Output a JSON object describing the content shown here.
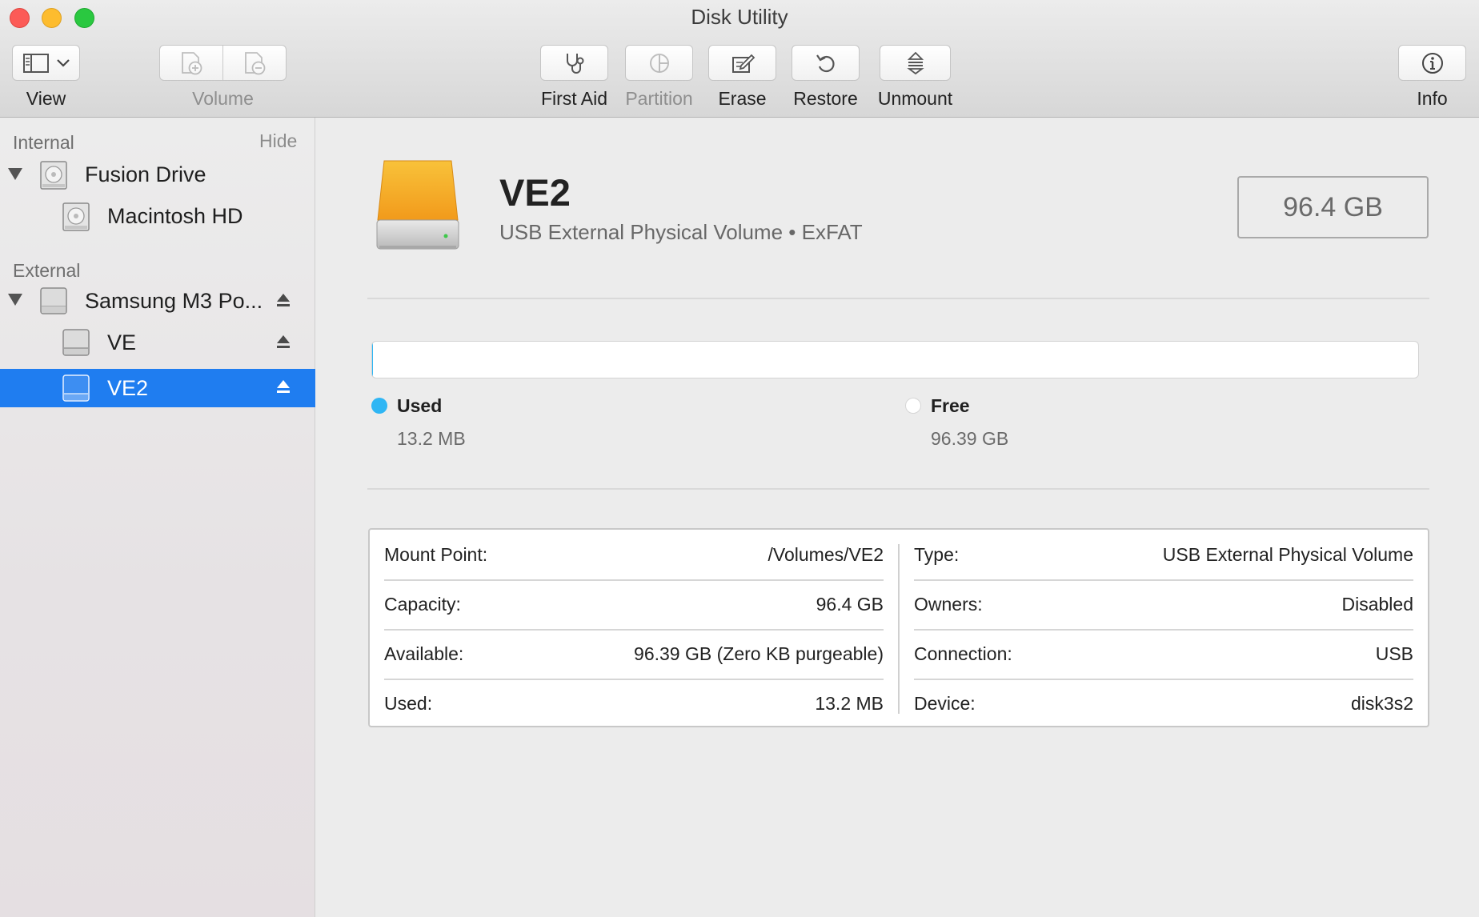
{
  "window": {
    "title": "Disk Utility"
  },
  "toolbar": {
    "view_label": "View",
    "volume_label": "Volume",
    "first_aid_label": "First Aid",
    "partition_label": "Partition",
    "erase_label": "Erase",
    "restore_label": "Restore",
    "unmount_label": "Unmount",
    "info_label": "Info"
  },
  "sidebar": {
    "internal_header": "Internal",
    "hide_label": "Hide",
    "external_header": "External",
    "internal_items": [
      {
        "label": "Fusion Drive"
      },
      {
        "label": "Macintosh HD"
      }
    ],
    "external_items": [
      {
        "label": "Samsung M3 Po..."
      },
      {
        "label": "VE"
      },
      {
        "label": "VE2"
      }
    ]
  },
  "volume": {
    "name": "VE2",
    "subtitle": "USB External Physical Volume • ExFAT",
    "size": "96.4 GB"
  },
  "usage": {
    "used_fraction": 0.0001,
    "used_label": "Used",
    "used_value": "13.2 MB",
    "free_label": "Free",
    "free_value": "96.39 GB",
    "used_color": "#2fb6f4",
    "free_color": "#ffffff"
  },
  "info": {
    "left": [
      {
        "key": "Mount Point:",
        "value": "/Volumes/VE2"
      },
      {
        "key": "Capacity:",
        "value": "96.4 GB"
      },
      {
        "key": "Available:",
        "value": "96.39 GB (Zero KB purgeable)"
      },
      {
        "key": "Used:",
        "value": "13.2 MB"
      }
    ],
    "right": [
      {
        "key": "Type:",
        "value": "USB External Physical Volume"
      },
      {
        "key": "Owners:",
        "value": "Disabled"
      },
      {
        "key": "Connection:",
        "value": "USB"
      },
      {
        "key": "Device:",
        "value": "disk3s2"
      }
    ]
  },
  "colors": {
    "selection": "#1f7df0",
    "drive_orange": "#f5a623"
  }
}
